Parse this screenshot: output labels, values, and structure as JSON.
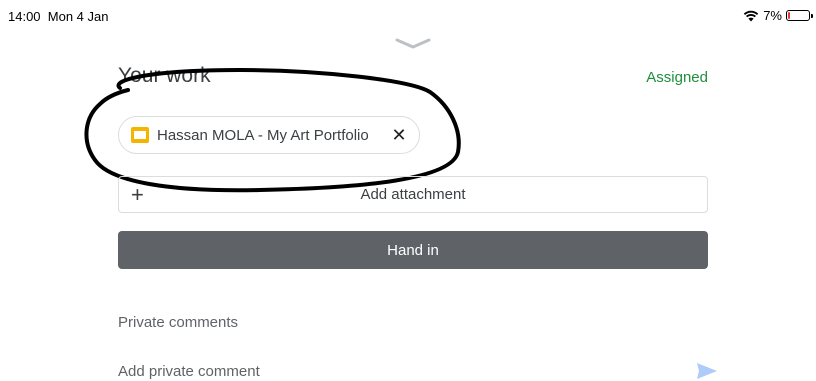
{
  "status_bar": {
    "time": "14:00",
    "date": "Mon 4 Jan",
    "battery": "7%",
    "battery_level": 0.07,
    "wifi_icon": "wifi-icon"
  },
  "sheet": {
    "handle_icon": "chevron-down-icon"
  },
  "your_work": {
    "title": "Your work",
    "status": "Assigned",
    "status_color": "#1e8e3e",
    "attachment": {
      "icon": "slides-icon",
      "icon_color": "#f4b400",
      "name": "Hassan MOLA - My Art Portfolio",
      "remove_icon": "close-icon"
    },
    "add_attachment_label": "Add attachment",
    "add_icon": "plus-icon",
    "hand_in_label": "Hand in"
  },
  "private_comments": {
    "heading": "Private comments",
    "placeholder": "Add private comment",
    "send_icon": "send-icon"
  }
}
